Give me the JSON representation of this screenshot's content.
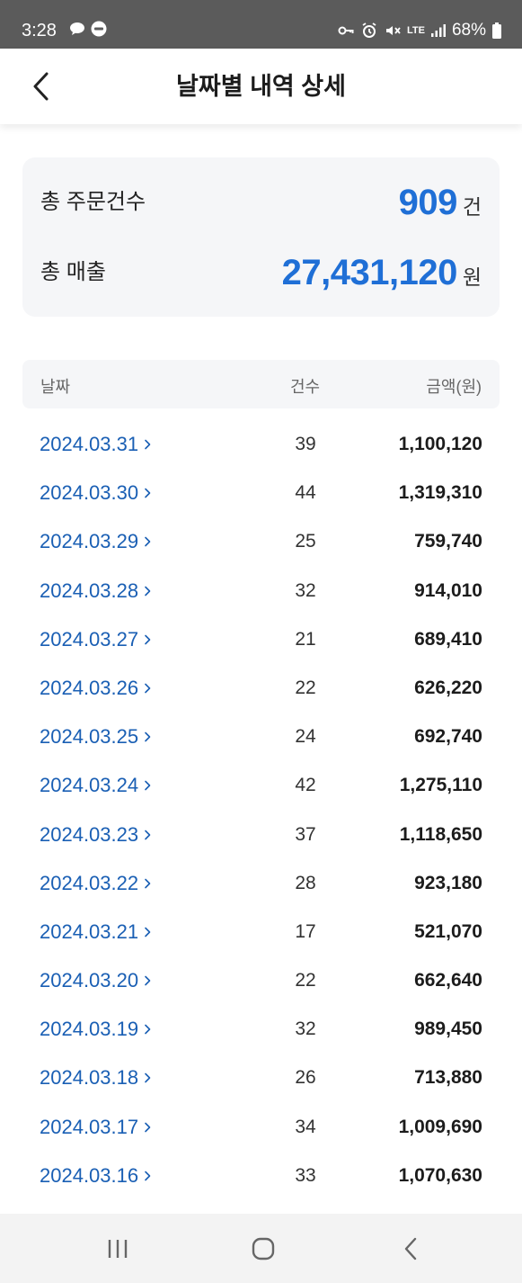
{
  "status_bar": {
    "time": "3:28",
    "battery": "68%",
    "network": "LTE",
    "icons": [
      "chat-bubble-icon",
      "eats-app-icon",
      "vpn-key-icon",
      "alarm-icon",
      "mute-icon",
      "lte-icon",
      "signal-icon",
      "battery-icon"
    ]
  },
  "header": {
    "title": "날짜별 내역 상세",
    "back_icon": "chevron-left-icon"
  },
  "summary": {
    "orders_label": "총 주문건수",
    "orders_value": "909",
    "orders_unit": "건",
    "sales_label": "총 매출",
    "sales_value": "27,431,120",
    "sales_unit": "원",
    "accent_color": "#1f6fd6"
  },
  "table": {
    "headers": {
      "date": "날짜",
      "count": "건수",
      "amount": "금액(원)"
    },
    "rows": [
      {
        "date": "2024.03.31",
        "count": "39",
        "amount": "1,100,120"
      },
      {
        "date": "2024.03.30",
        "count": "44",
        "amount": "1,319,310"
      },
      {
        "date": "2024.03.29",
        "count": "25",
        "amount": "759,740"
      },
      {
        "date": "2024.03.28",
        "count": "32",
        "amount": "914,010"
      },
      {
        "date": "2024.03.27",
        "count": "21",
        "amount": "689,410"
      },
      {
        "date": "2024.03.26",
        "count": "22",
        "amount": "626,220"
      },
      {
        "date": "2024.03.25",
        "count": "24",
        "amount": "692,740"
      },
      {
        "date": "2024.03.24",
        "count": "42",
        "amount": "1,275,110"
      },
      {
        "date": "2024.03.23",
        "count": "37",
        "amount": "1,118,650"
      },
      {
        "date": "2024.03.22",
        "count": "28",
        "amount": "923,180"
      },
      {
        "date": "2024.03.21",
        "count": "17",
        "amount": "521,070"
      },
      {
        "date": "2024.03.20",
        "count": "22",
        "amount": "662,640"
      },
      {
        "date": "2024.03.19",
        "count": "32",
        "amount": "989,450"
      },
      {
        "date": "2024.03.18",
        "count": "26",
        "amount": "713,880"
      },
      {
        "date": "2024.03.17",
        "count": "34",
        "amount": "1,009,690"
      },
      {
        "date": "2024.03.16",
        "count": "33",
        "amount": "1,070,630"
      }
    ]
  },
  "nav_bar": {
    "icons": [
      "recents-icon",
      "home-icon",
      "back-icon"
    ]
  }
}
